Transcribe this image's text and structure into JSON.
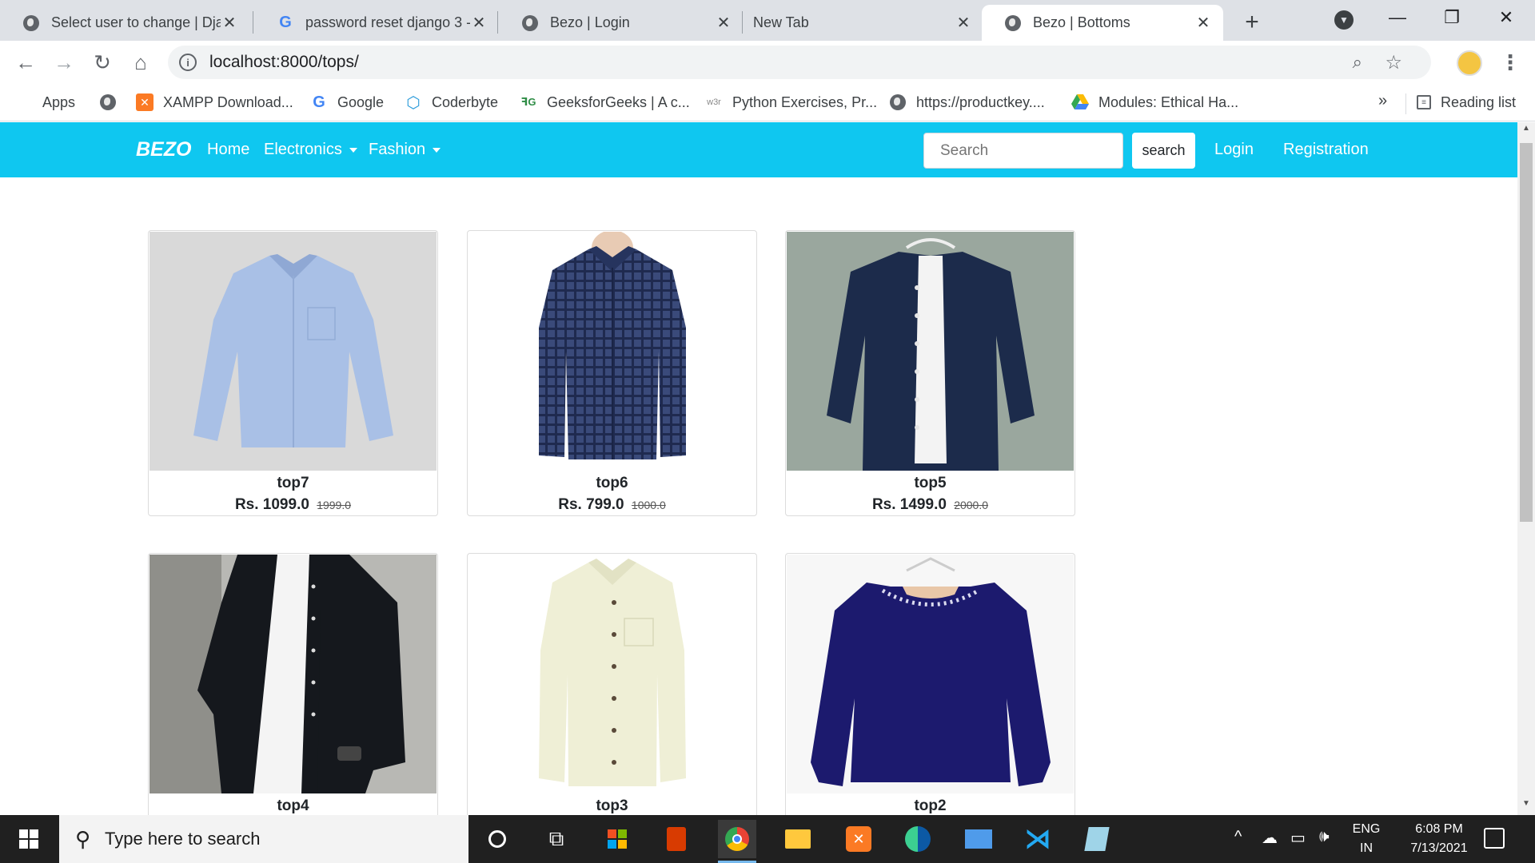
{
  "browser": {
    "tabs": [
      {
        "title": "Select user to change | Dja",
        "icon": "globe-icon"
      },
      {
        "title": "password reset django 3 -",
        "icon": "google-icon"
      },
      {
        "title": "Bezo | Login",
        "icon": "globe-icon"
      },
      {
        "title": "New Tab",
        "icon": ""
      },
      {
        "title": "Bezo | Bottoms",
        "icon": "globe-icon",
        "active": true
      }
    ],
    "url": "localhost:8000/tops/",
    "bookmarks": [
      {
        "label": "Apps",
        "icon": "apps-grid-icon"
      },
      {
        "label": "",
        "icon": "globe-icon"
      },
      {
        "label": "XAMPP Download...",
        "icon": "xampp-icon"
      },
      {
        "label": "Google",
        "icon": "google-icon"
      },
      {
        "label": "Coderbyte",
        "icon": "coderbyte-icon"
      },
      {
        "label": "GeeksforGeeks | A c...",
        "icon": "geeksforgeeks-icon"
      },
      {
        "label": "Python Exercises, Pr...",
        "icon": "w3r-icon"
      },
      {
        "label": "https://productkey....",
        "icon": "globe-icon"
      },
      {
        "label": "Modules: Ethical Ha...",
        "icon": "drive-icon"
      }
    ],
    "bookmarks_more": "»",
    "reading_list": "Reading list"
  },
  "site": {
    "brand": "BEZO",
    "nav": {
      "home": "Home",
      "electronics": "Electronics",
      "fashion": "Fashion",
      "login": "Login",
      "registration": "Registration"
    },
    "search": {
      "placeholder": "Search",
      "button": "search"
    },
    "accent_color": "#0fc7f0"
  },
  "products": [
    {
      "name": "top7",
      "price": "Rs. 1099.0",
      "old_price": "1999.0"
    },
    {
      "name": "top6",
      "price": "Rs. 799.0",
      "old_price": "1000.0"
    },
    {
      "name": "top5",
      "price": "Rs. 1499.0",
      "old_price": "2000.0"
    },
    {
      "name": "top4",
      "price": "",
      "old_price": ""
    },
    {
      "name": "top3",
      "price": "",
      "old_price": ""
    },
    {
      "name": "top2",
      "price": "",
      "old_price": ""
    }
  ],
  "taskbar": {
    "search_placeholder": "Type here to search",
    "lang_1": "ENG",
    "lang_2": "IN",
    "time": "6:08 PM",
    "date": "7/13/2021"
  }
}
